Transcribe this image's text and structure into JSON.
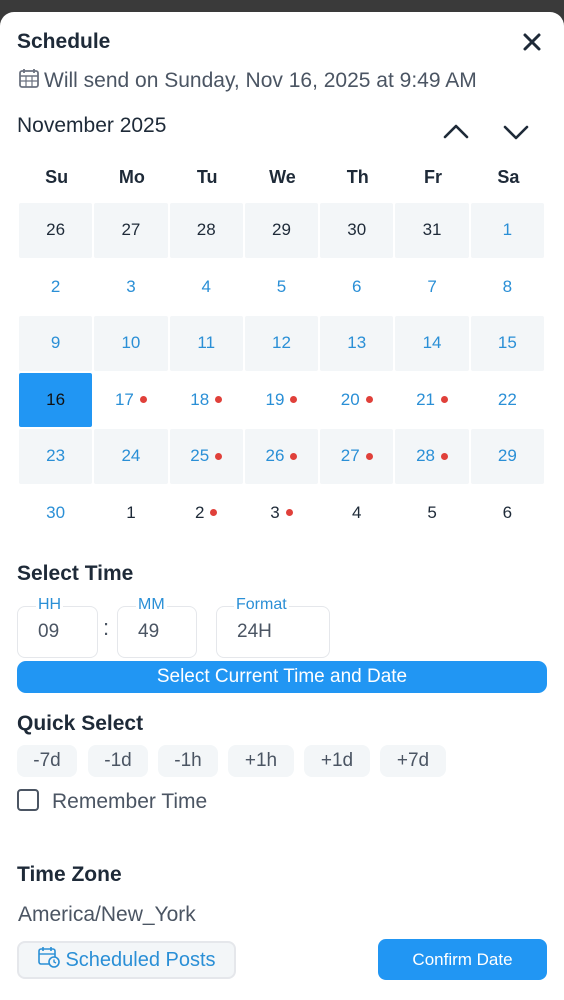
{
  "header": {
    "title": "Schedule",
    "send_text": "Will send on Sunday, Nov 16, 2025 at 9:49 AM"
  },
  "calendar": {
    "month_label": "November 2025",
    "weekdays": [
      "Su",
      "Mo",
      "Tu",
      "We",
      "Th",
      "Fr",
      "Sa"
    ],
    "weeks": [
      [
        {
          "d": "26",
          "o": true,
          "s": true
        },
        {
          "d": "27",
          "o": true,
          "s": true
        },
        {
          "d": "28",
          "o": true,
          "s": true
        },
        {
          "d": "29",
          "o": true,
          "s": true
        },
        {
          "d": "30",
          "o": true,
          "s": true
        },
        {
          "d": "31",
          "o": true,
          "s": true
        },
        {
          "d": "1",
          "s": true
        }
      ],
      [
        {
          "d": "2"
        },
        {
          "d": "3"
        },
        {
          "d": "4"
        },
        {
          "d": "5"
        },
        {
          "d": "6"
        },
        {
          "d": "7"
        },
        {
          "d": "8"
        }
      ],
      [
        {
          "d": "9",
          "s": true
        },
        {
          "d": "10",
          "s": true
        },
        {
          "d": "11",
          "s": true
        },
        {
          "d": "12",
          "s": true
        },
        {
          "d": "13",
          "s": true
        },
        {
          "d": "14",
          "s": true
        },
        {
          "d": "15",
          "s": true
        }
      ],
      [
        {
          "d": "16",
          "sel": true
        },
        {
          "d": "17",
          "dot": true
        },
        {
          "d": "18",
          "dot": true
        },
        {
          "d": "19",
          "dot": true
        },
        {
          "d": "20",
          "dot": true
        },
        {
          "d": "21",
          "dot": true
        },
        {
          "d": "22"
        }
      ],
      [
        {
          "d": "23",
          "s": true
        },
        {
          "d": "24",
          "s": true
        },
        {
          "d": "25",
          "s": true,
          "dot": true
        },
        {
          "d": "26",
          "s": true,
          "dot": true
        },
        {
          "d": "27",
          "s": true,
          "dot": true
        },
        {
          "d": "28",
          "s": true,
          "dot": true
        },
        {
          "d": "29",
          "s": true
        }
      ],
      [
        {
          "d": "30"
        },
        {
          "d": "1",
          "o": true
        },
        {
          "d": "2",
          "o": true,
          "dot": true
        },
        {
          "d": "3",
          "o": true,
          "dot": true
        },
        {
          "d": "4",
          "o": true
        },
        {
          "d": "5",
          "o": true
        },
        {
          "d": "6",
          "o": true
        }
      ]
    ]
  },
  "time": {
    "section_title": "Select Time",
    "hh_label": "HH",
    "hh_value": "09",
    "separator": ":",
    "mm_label": "MM",
    "mm_value": "49",
    "format_label": "Format",
    "format_value": "24H",
    "current_button": "Select Current Time and Date"
  },
  "quick": {
    "section_title": "Quick Select",
    "options": [
      "-7d",
      "-1d",
      "-1h",
      "+1h",
      "+1d",
      "+7d"
    ],
    "remember_label": "Remember Time",
    "remember_checked": false
  },
  "timezone": {
    "section_title": "Time Zone",
    "value": "America/New_York"
  },
  "footer": {
    "scheduled_label": "Scheduled Posts",
    "confirm_label": "Confirm Date"
  },
  "colors": {
    "accent": "#2196f3",
    "link": "#2a8fd6",
    "dot": "#e0403a"
  }
}
